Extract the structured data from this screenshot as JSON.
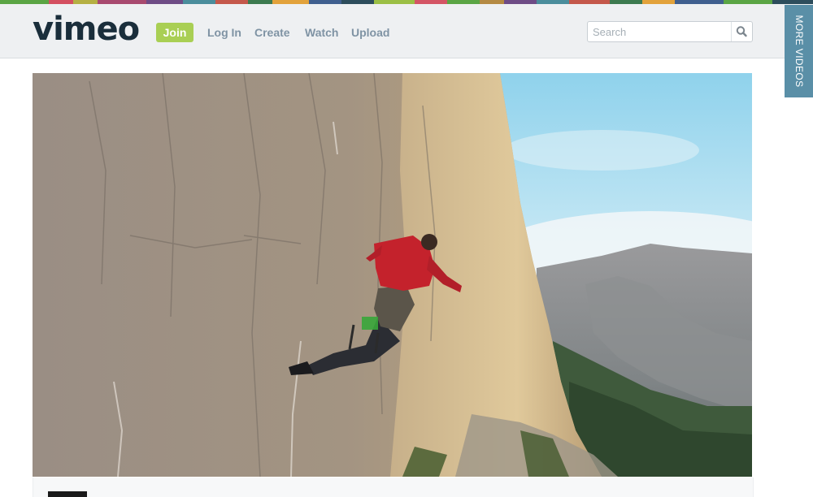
{
  "brand": {
    "logo_text": "vimeo"
  },
  "header": {
    "join_label": "Join",
    "nav": [
      {
        "label": "Log In"
      },
      {
        "label": "Create"
      },
      {
        "label": "Watch"
      },
      {
        "label": "Upload"
      }
    ],
    "search": {
      "placeholder": "Search",
      "icon": "search-icon"
    }
  },
  "sidebar_tab": {
    "label": "MORE VIDEOS"
  },
  "video": {
    "thumbnail": "climber on rock face, Yosemite valley"
  },
  "colors": {
    "join_green": "#a9cf54",
    "nav_text": "#7f93a4",
    "logo": "#1a2e3b",
    "more_videos_tab": "#5a8fa7"
  }
}
